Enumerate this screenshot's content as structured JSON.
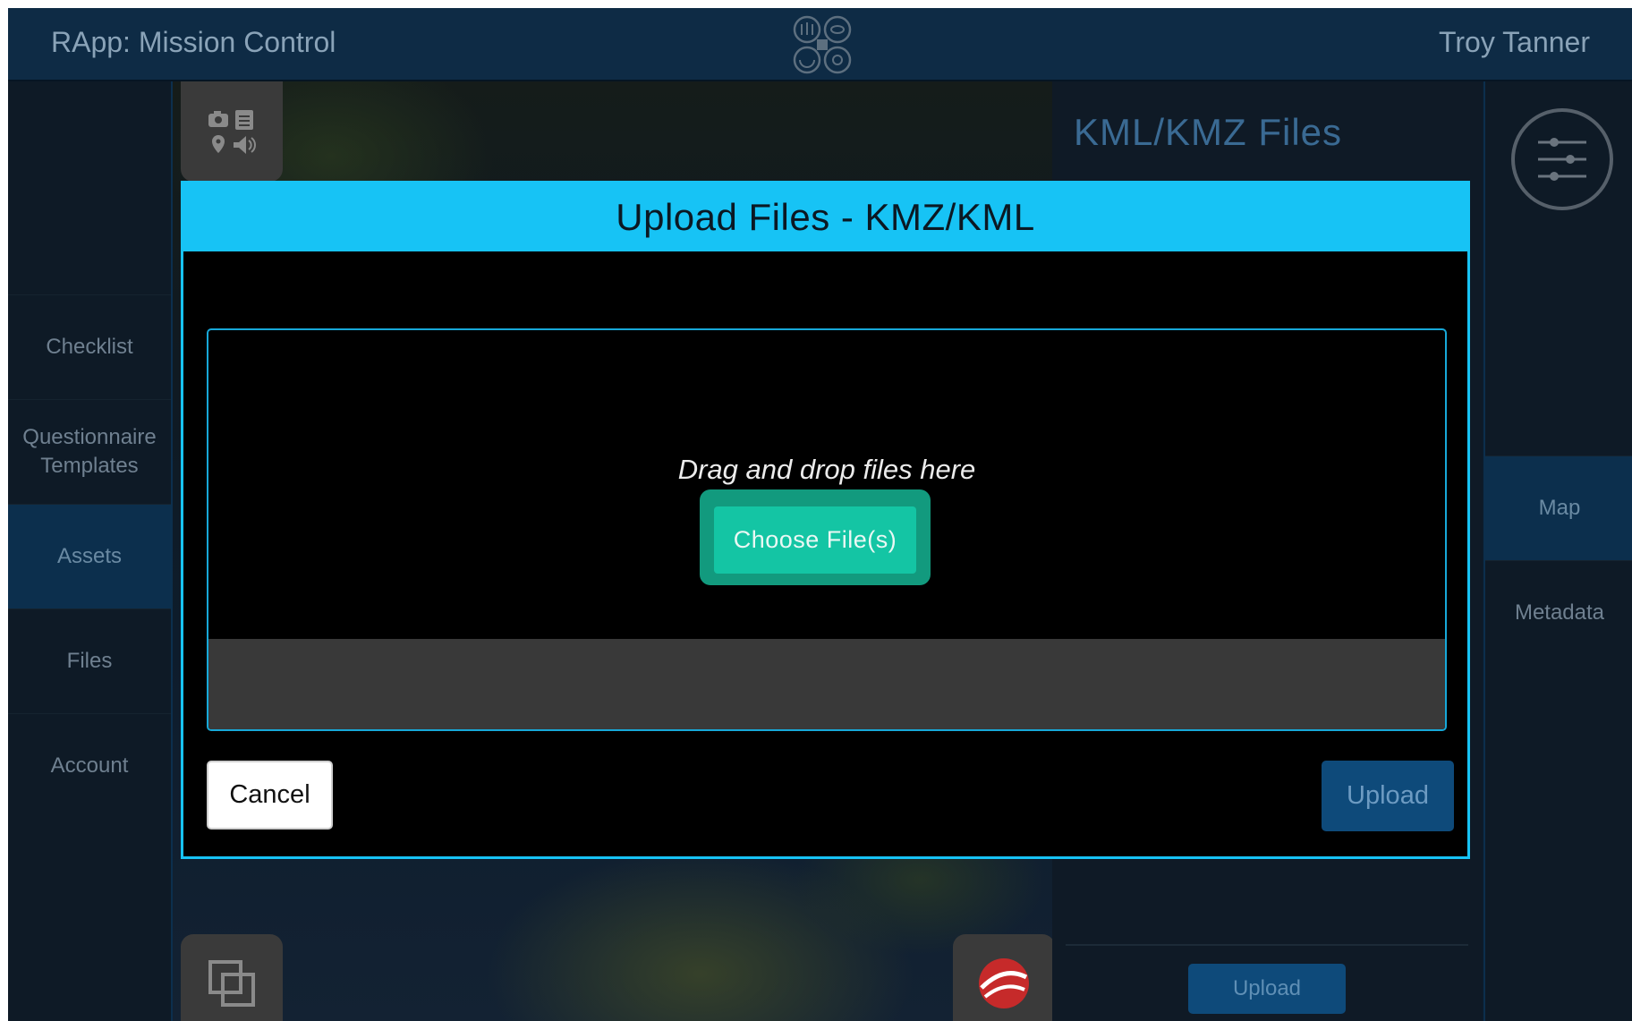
{
  "header": {
    "app_title": "RApp: Mission Control",
    "user_name": "Troy Tanner",
    "logo_icon": "mission-control-logo-icon"
  },
  "sidebar_left": {
    "items": [
      {
        "label": "Checklist",
        "active": false
      },
      {
        "label": "Questionnaire Templates",
        "active": false
      },
      {
        "label": "Assets",
        "active": true
      },
      {
        "label": "Files",
        "active": false
      },
      {
        "label": "Account",
        "active": false
      }
    ]
  },
  "map": {
    "top_controls_icons": [
      "camera-icon",
      "clipboard-icon",
      "location-pin-icon",
      "speaker-icon"
    ],
    "bottom_left_icon": "layers-icon",
    "bottom_right_icon": "google-earth-icon"
  },
  "kml_panel": {
    "title": "KML/KMZ Files",
    "upload_label": "Upload"
  },
  "sidebar_right": {
    "filter_icon": "sliders-icon",
    "items": [
      {
        "label": "Map",
        "active": true
      },
      {
        "label": "Metadata",
        "active": false
      }
    ]
  },
  "modal": {
    "title": "Upload Files - KMZ/KML",
    "drop_text": "Drag and drop files here",
    "choose_label": "Choose File(s)",
    "cancel_label": "Cancel",
    "upload_label": "Upload"
  },
  "colors": {
    "accent": "#17c3f5",
    "choose_button": "#14c5a4",
    "header_bg": "#0e2b45",
    "active_nav": "#0c2f4d",
    "primary_button": "#0e4a7a"
  }
}
